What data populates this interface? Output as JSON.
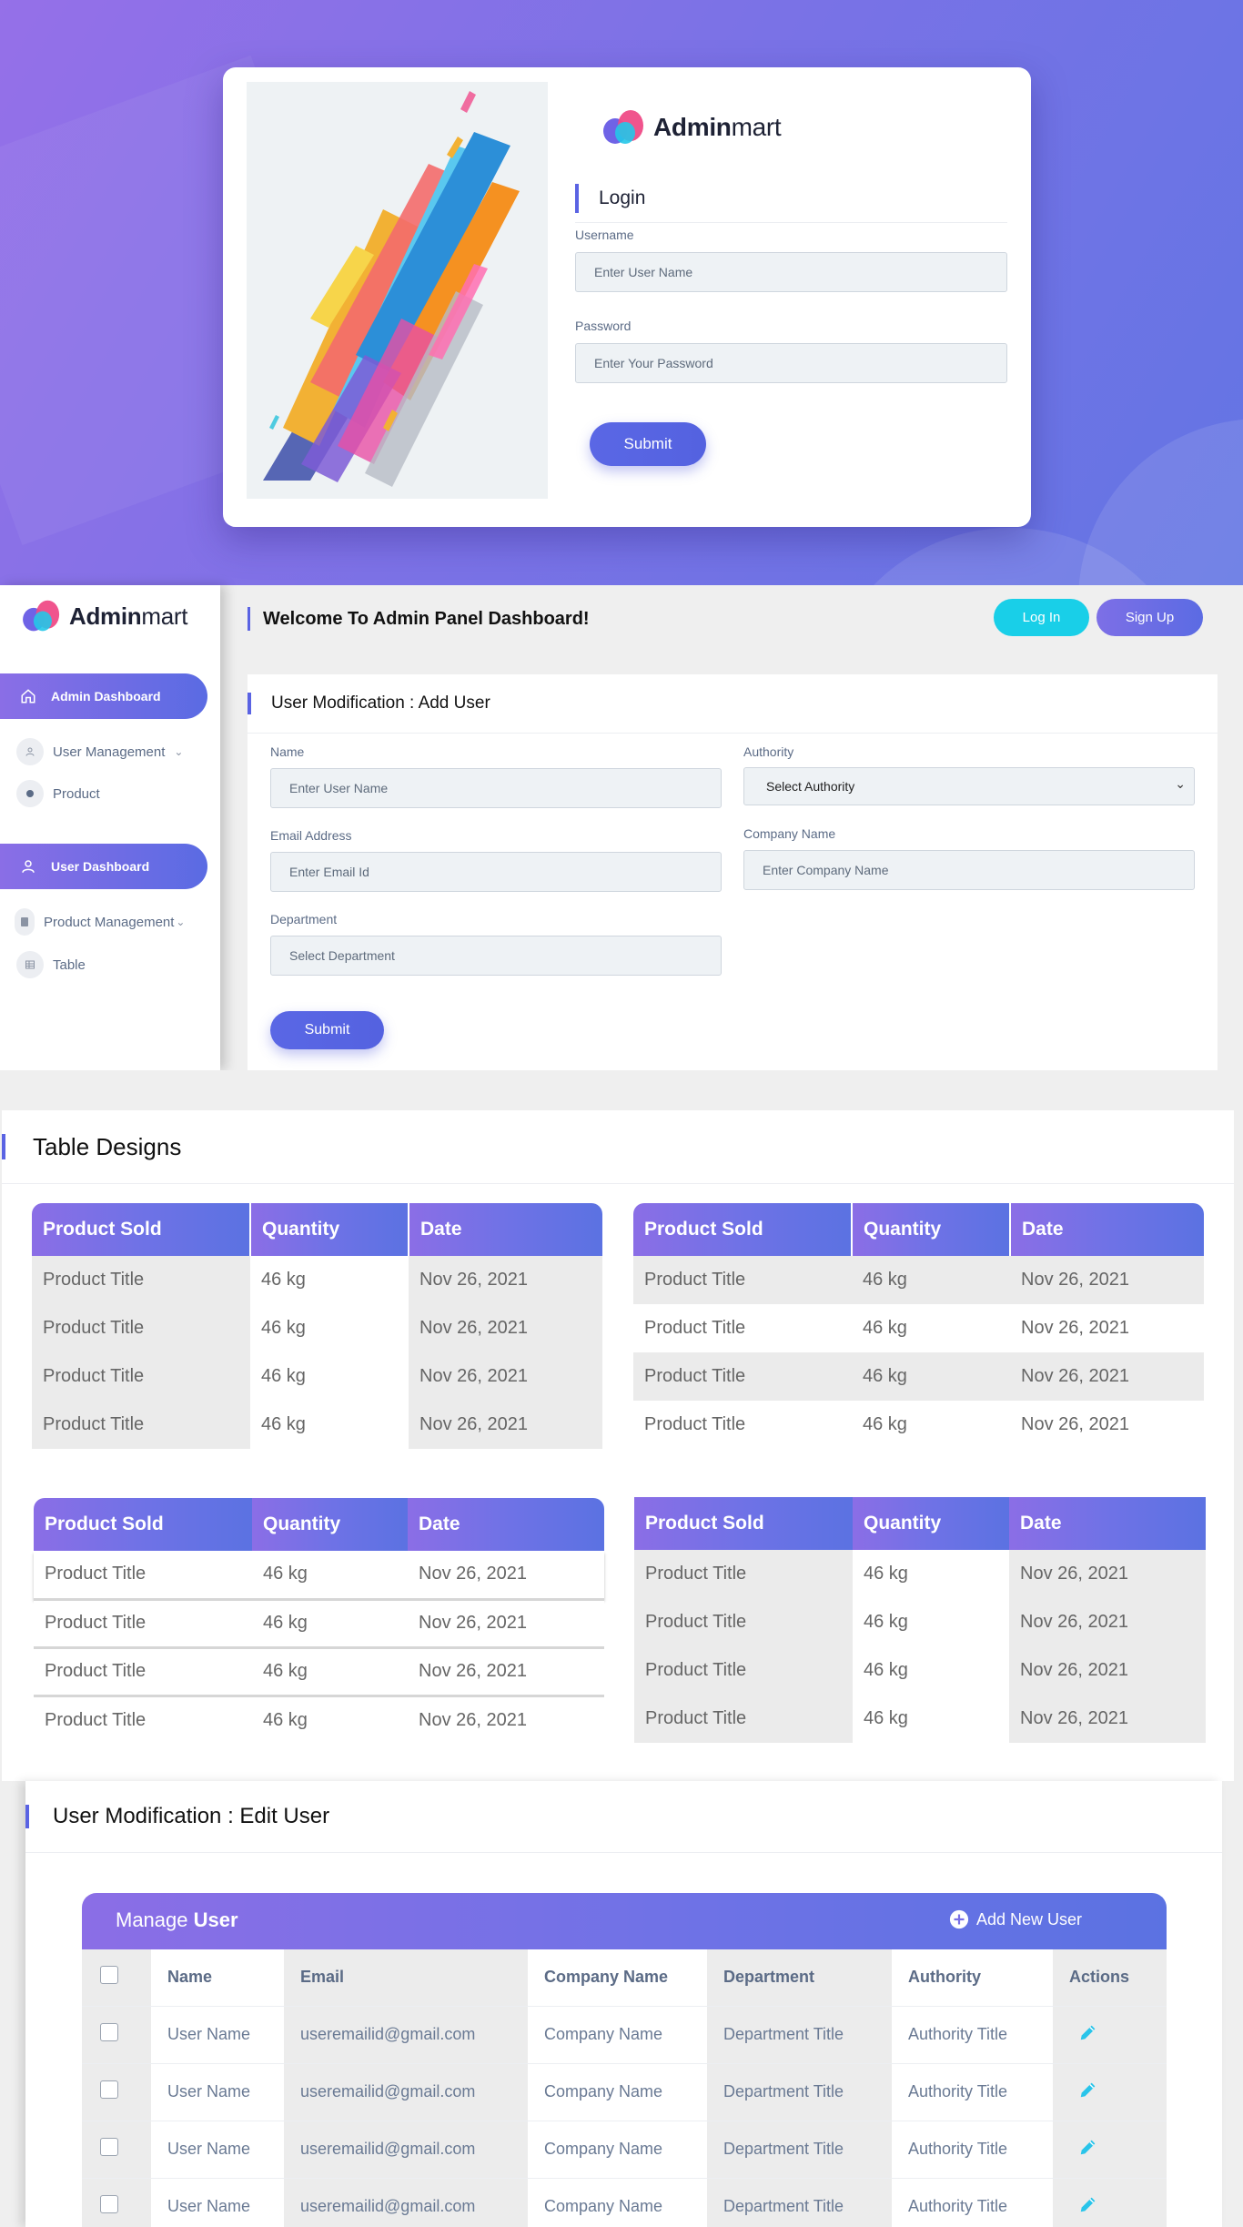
{
  "login": {
    "brand": {
      "bold": "Admin",
      "light": "mart"
    },
    "title": "Login",
    "username_label": "Username",
    "username_placeholder": "Enter User Name",
    "password_label": "Password",
    "password_placeholder": "Enter Your Password",
    "submit_label": "Submit"
  },
  "dashboard": {
    "brand": {
      "bold": "Admin",
      "light": "mart"
    },
    "header_title": "Welcome To Admin Panel Dashboard!",
    "login_button": "Log In",
    "signup_button": "Sign Up",
    "sidebar": {
      "admin_dashboard": "Admin Dashboard",
      "user_management": "User Management",
      "product": "Product",
      "user_dashboard": "User Dashboard",
      "product_management": "Product Management",
      "table": "Table"
    },
    "form": {
      "title": "User Modification : Add User",
      "name_label": "Name",
      "name_placeholder": "Enter User Name",
      "email_label": "Email Address",
      "email_placeholder": "Enter Email Id",
      "department_label": "Department",
      "department_placeholder": "Select Department",
      "authority_label": "Authority",
      "authority_value": "Select Authority",
      "company_label": "Company Name",
      "company_placeholder": "Enter Company Name",
      "submit_label": "Submit"
    }
  },
  "tables": {
    "title": "Table Designs",
    "headers": [
      "Product Sold",
      "Quantity",
      "Date"
    ],
    "rows": [
      [
        "Product Title",
        "46 kg",
        "Nov 26, 2021"
      ],
      [
        "Product Title",
        "46 kg",
        "Nov 26, 2021"
      ],
      [
        "Product Title",
        "46 kg",
        "Nov 26, 2021"
      ],
      [
        "Product Title",
        "46 kg",
        "Nov 26, 2021"
      ]
    ]
  },
  "edit_user": {
    "title": "User Modification : Edit User",
    "manage_prefix": "Manage",
    "manage_bold": "User",
    "add_new_user": "Add New User",
    "headers": [
      "Name",
      "Email",
      "Company Name",
      "Department",
      "Authority",
      "Actions"
    ],
    "rows": [
      [
        "User Name",
        "useremailid@gmail.com",
        "Company Name",
        "Department Title",
        "Authority Title"
      ],
      [
        "User Name",
        "useremailid@gmail.com",
        "Company Name",
        "Department Title",
        "Authority Title"
      ],
      [
        "User Name",
        "useremailid@gmail.com",
        "Company Name",
        "Department Title",
        "Authority Title"
      ],
      [
        "User Name",
        "useremailid@gmail.com",
        "Company Name",
        "Department Title",
        "Authority Title"
      ]
    ]
  },
  "colors": {
    "accent": "#5a63e3",
    "purple": "#8b6ee6",
    "cyan": "#19cfe8",
    "edit_icon": "#29c4ea"
  }
}
